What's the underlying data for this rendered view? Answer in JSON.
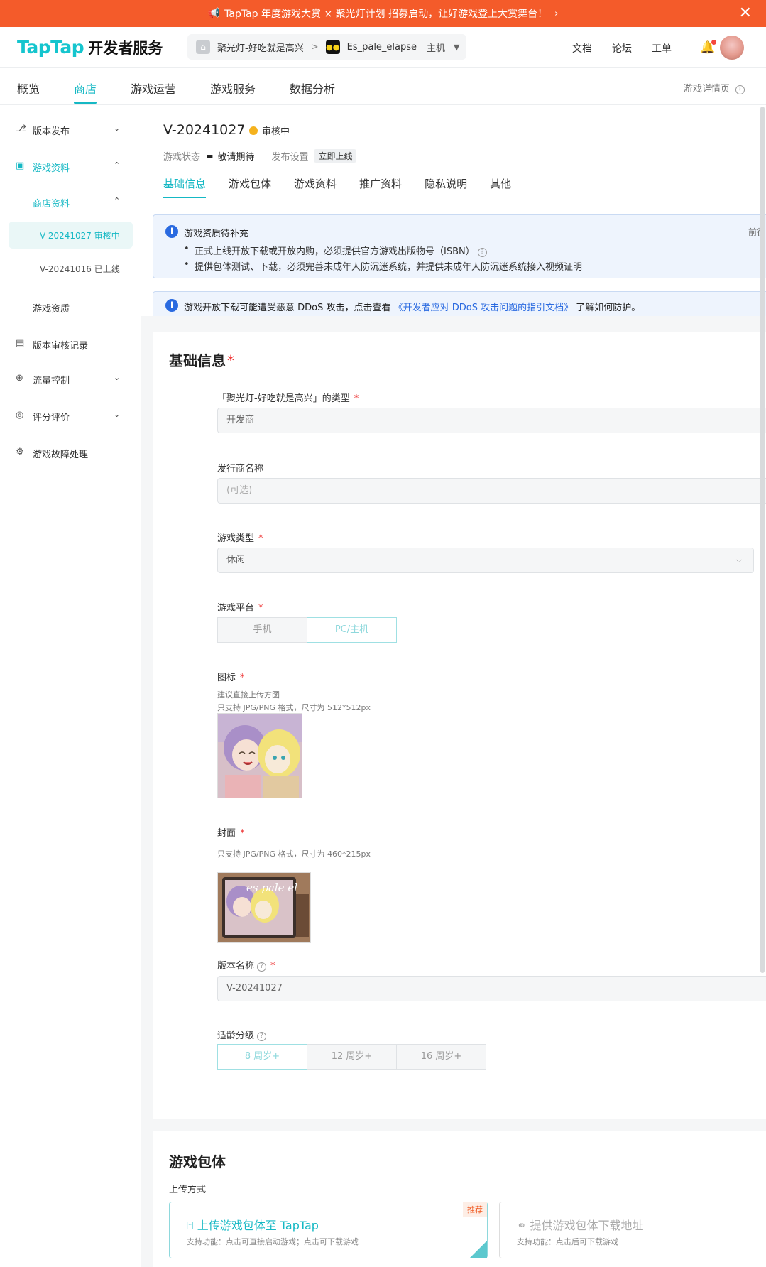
{
  "banner": {
    "text": "TapTap 年度游戏大赏 × 聚光灯计划 招募启动，让好游戏登上大赏舞台！",
    "chevron": "›",
    "close": "✕"
  },
  "header": {
    "logo": "TapTap",
    "logo_suffix": "开发者服务",
    "project_name": "聚光灯-好吃就是高兴",
    "separator": ">",
    "game_name": "Es_pale_elapse",
    "platform": "主机",
    "links": {
      "docs": "文档",
      "forum": "论坛",
      "ticket": "工单"
    }
  },
  "topnav": {
    "items": [
      "概览",
      "商店",
      "游戏运营",
      "游戏服务",
      "数据分析"
    ],
    "active": "商店",
    "detail": "游戏详情页"
  },
  "sidebar": {
    "version_publish": "版本发布",
    "game_info": "游戏资料",
    "store_info": "商店资料",
    "v1": "V-20241027 审核中",
    "v2": "V-20241016 已上线",
    "qualification": "游戏资质",
    "review_log": "版本审核记录",
    "traffic": "流量控制",
    "rating": "评分评价",
    "fault": "游戏故障处理"
  },
  "version": {
    "title": "V-20241027",
    "status": "审核中",
    "state_label": "游戏状态",
    "state_value": "敬请期待",
    "publish_label": "发布设置",
    "publish_value": "立即上线"
  },
  "tabs": [
    "基础信息",
    "游戏包体",
    "游戏资料",
    "推广资料",
    "隐私说明",
    "其他"
  ],
  "notices": {
    "n1_title": "游戏资质待补充",
    "n1_right": "前往",
    "n1_b1": "正式上线开放下载或开放内购，必须提供官方游戏出版物号（ISBN）",
    "n1_b2": "提供包体测试、下载，必须完善未成年人防沉迷系统，并提供未成年人防沉迷系统接入视频证明",
    "n2_pre": "游戏开放下载可能遭受恶意 DDoS 攻击，点击查看",
    "n2_link": "《开发者应对 DDoS 攻击问题的指引文档》",
    "n2_post": "了解如何防护。"
  },
  "basic": {
    "title": "基础信息",
    "type_label": "「聚光灯-好吃就是高兴」的类型",
    "type_value": "开发商",
    "publisher_label": "发行商名称",
    "publisher_placeholder": "(可选)",
    "genre_label": "游戏类型",
    "genre_value": "休闲",
    "platform_label": "游戏平台",
    "platform_options": [
      "手机",
      "PC/主机"
    ],
    "icon_label": "图标",
    "icon_hint1": "建议直接上传方图",
    "icon_hint2": "只支持 JPG/PNG 格式，尺寸为 512*512px",
    "cover_label": "封面",
    "cover_hint": "只支持 JPG/PNG 格式，尺寸为 460*215px",
    "cover_text": "es pale el",
    "version_label": "版本名称",
    "version_value": "V-20241027",
    "age_label": "适龄分级",
    "age_options": [
      "8 周岁+",
      "12 周岁+",
      "16 周岁+"
    ]
  },
  "package": {
    "title": "游戏包体",
    "upload_label": "上传方式",
    "opt1_title": "上传游戏包体至 TapTap",
    "opt1_desc": "支持功能：点击可直接启动游戏；点击可下载游戏",
    "opt1_badge": "推荐",
    "opt2_title": "提供游戏包体下载地址",
    "opt2_desc": "支持功能：点击后可下载游戏"
  },
  "colors": {
    "accent": "#15b8c4",
    "banner": "#f45b2a",
    "info": "#2a6ae0",
    "pending": "#f5b21d"
  }
}
